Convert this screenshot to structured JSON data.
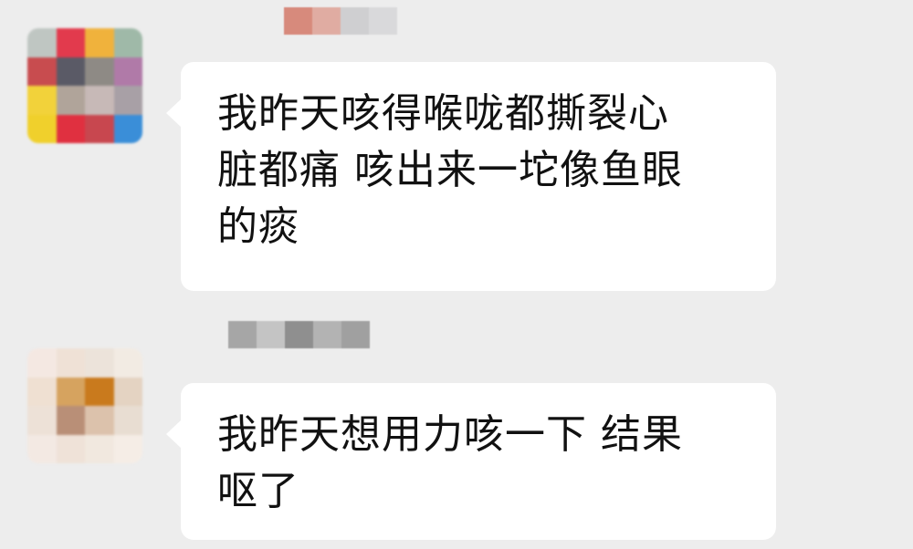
{
  "chat": {
    "messages": [
      {
        "text": "我昨天咳得喉咙都撕裂心\n脏都痛 咳出来一坨像鱼眼\n的痰",
        "avatar_pixels": [
          "#bfc6c2",
          "#e23a4d",
          "#f0b23c",
          "#9fb9a8",
          "#c84c4f",
          "#5a5a66",
          "#8e8a85",
          "#b07aa8",
          "#f2d23a",
          "#b0a49a",
          "#c7b9b7",
          "#a8a0a6",
          "#f0d02c",
          "#e03040",
          "#c8474f",
          "#3a8ed8"
        ],
        "name_pixels": [
          "#d78a7c",
          "#e0aca2",
          "#cfcfd1",
          "#d9d9db"
        ]
      },
      {
        "text": "我昨天想用力咳一下 结果\n呕了",
        "avatar_pixels": [
          "#f4e8e2",
          "#efe1d6",
          "#ece3da",
          "#f2ebe3",
          "#efe0d2",
          "#d6a35f",
          "#c97a1d",
          "#e4d3c2",
          "#ede1d7",
          "#b98f77",
          "#dcc2ac",
          "#e8ddd2",
          "#f3e9e3",
          "#efe2d8",
          "#f1e8df",
          "#f5ede6"
        ],
        "name_pixels": [
          "#a6a6a6",
          "#c4c4c4",
          "#8f8f8f",
          "#b3b3b3",
          "#a0a0a0"
        ]
      }
    ]
  }
}
